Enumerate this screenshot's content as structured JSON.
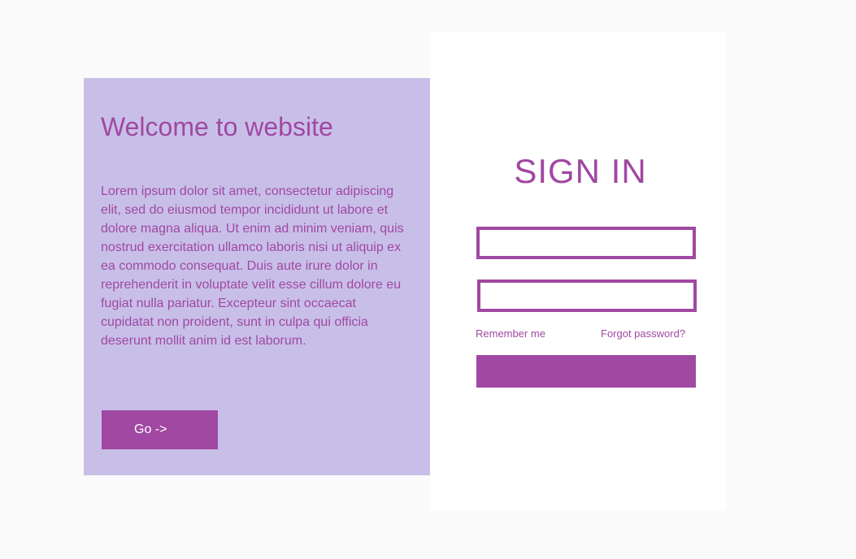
{
  "colors": {
    "page_background": "#fafafa",
    "welcome_panel": "#c8bfe8",
    "accent": "#a048a2",
    "card_background": "#ffffff",
    "button_text": "#ffffff"
  },
  "welcome": {
    "title": "Welcome to website",
    "body": "Lorem ipsum dolor sit amet, consectetur adipiscing elit, sed do eiusmod tempor incididunt ut labore et dolore magna aliqua. Ut enim ad minim veniam, quis nostrud exercitation ullamco laboris nisi ut aliquip ex ea commodo consequat. Duis aute irure dolor in reprehenderit in voluptate velit esse cillum dolore eu fugiat nulla pariatur. Excepteur sint occaecat cupidatat non proident, sunt in culpa qui officia deserunt mollit anim id est laborum.",
    "go_button_label": "Go ->"
  },
  "signin": {
    "title": "SIGN IN",
    "username_value": "",
    "password_value": "",
    "remember_label": "Remember me",
    "forgot_label": "Forgot password?",
    "submit_label": ""
  }
}
